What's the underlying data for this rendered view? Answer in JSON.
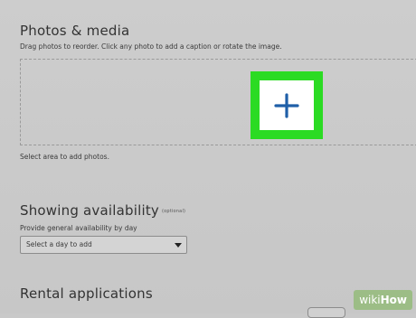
{
  "photos": {
    "title": "Photos & media",
    "instructions": "Drag photos to reorder. Click any photo to add a caption or rotate the image.",
    "add_button_icon": "plus-icon",
    "helper": "Select area to add photos.",
    "accent_color": "#2bdb23",
    "plus_color": "#1f5fa8"
  },
  "availability": {
    "title": "Showing availability",
    "optional": "(optional)",
    "label": "Provide general availability by day",
    "select_value": "Select a day to add"
  },
  "rental": {
    "title": "Rental applications"
  },
  "watermark": {
    "wiki": "wiki",
    "how": "How"
  }
}
